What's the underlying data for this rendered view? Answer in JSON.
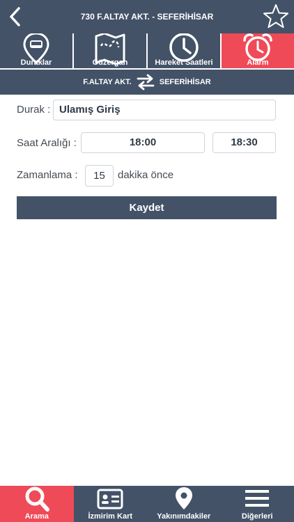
{
  "header": {
    "title": "730 F.ALTAY AKT. - SEFERİHİSAR",
    "back_icon": "chevron-left-icon",
    "favorite_icon": "star-outline-icon"
  },
  "tabs": [
    {
      "label": "Duraklar",
      "icon": "bus-stop-pin-icon",
      "active": false
    },
    {
      "label": "Güzergah",
      "icon": "route-map-icon",
      "active": false
    },
    {
      "label": "Hareket Saatleri",
      "icon": "clock-icon",
      "active": false
    },
    {
      "label": "Alarm",
      "icon": "alarm-clock-icon",
      "active": true
    }
  ],
  "direction": {
    "from": "F.ALTAY AKT.",
    "to": "SEFERİHİSAR",
    "icon": "swap-arrows-icon"
  },
  "form": {
    "stop_label": "Durak :",
    "stop_value": "Ulamış Giriş",
    "time_range_label": "Saat Aralığı :",
    "time_start": "18:00",
    "time_end": "18:30",
    "timing_label": "Zamanlama :",
    "timing_value": "15",
    "timing_suffix": "dakika önce",
    "save_label": "Kaydet"
  },
  "bottom_nav": [
    {
      "label": "Arama",
      "icon": "search-icon",
      "active": true
    },
    {
      "label": "İzmirim Kart",
      "icon": "id-card-icon",
      "active": false
    },
    {
      "label": "Yakınımdakiler",
      "icon": "location-pin-icon",
      "active": false
    },
    {
      "label": "Diğerleri",
      "icon": "menu-icon",
      "active": false
    }
  ],
  "colors": {
    "primary": "#435267",
    "accent": "#ef4a58",
    "background": "#ffffff"
  }
}
